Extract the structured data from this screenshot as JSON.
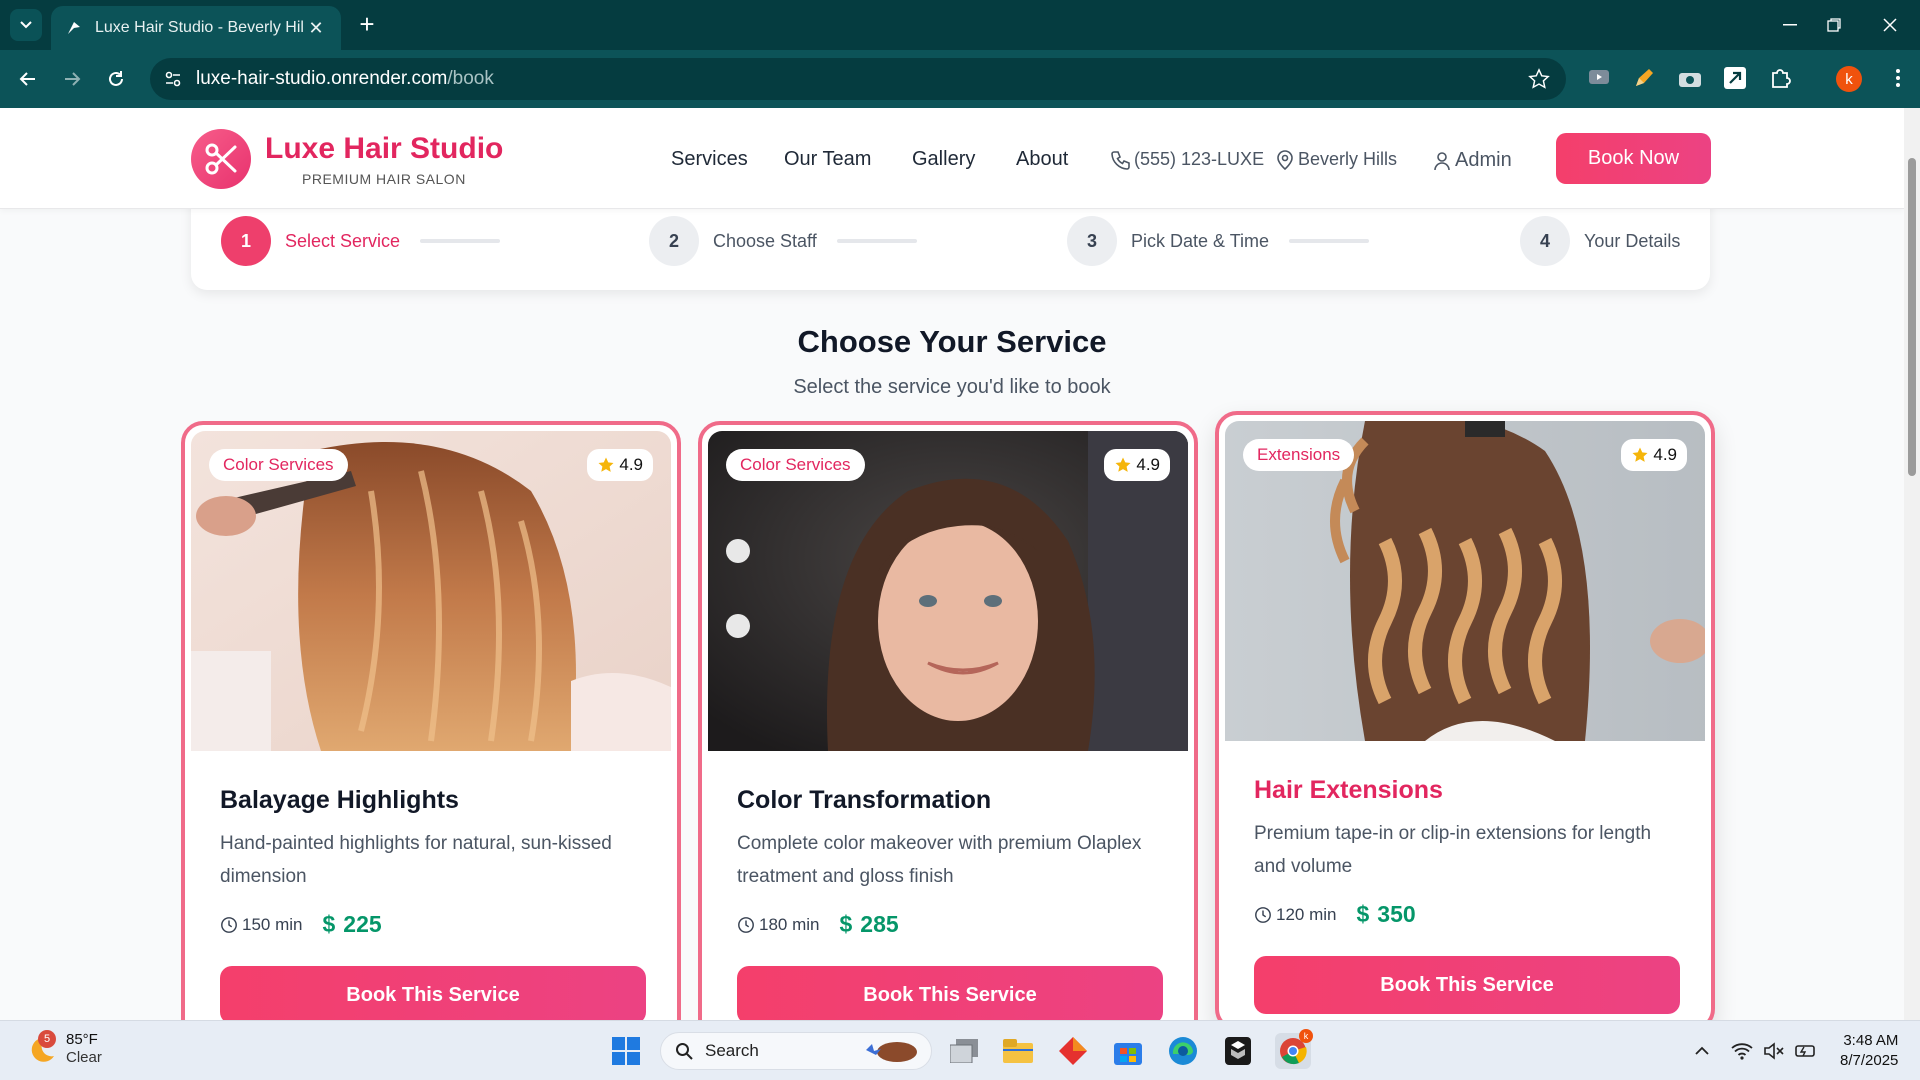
{
  "browser": {
    "tab_title": "Luxe Hair Studio - Beverly Hills |",
    "url_host": "luxe-hair-studio.onrender.com",
    "url_path": "/book",
    "profile_initial": "k"
  },
  "header": {
    "brand": "Luxe Hair Studio",
    "tagline": "PREMIUM HAIR SALON",
    "nav": [
      "Services",
      "Our Team",
      "Gallery",
      "About"
    ],
    "phone": "(555) 123-LUXE",
    "location": "Beverly Hills",
    "admin": "Admin",
    "book_now": "Book Now"
  },
  "steps": [
    {
      "num": "1",
      "label": "Select Service",
      "active": true
    },
    {
      "num": "2",
      "label": "Choose Staff",
      "active": false
    },
    {
      "num": "3",
      "label": "Pick Date & Time",
      "active": false
    },
    {
      "num": "4",
      "label": "Your Details",
      "active": false
    }
  ],
  "section": {
    "title": "Choose Your Service",
    "subtitle": "Select the service you'd like to book"
  },
  "services": [
    {
      "category": "Color Services",
      "rating": "4.9",
      "name": "Balayage Highlights",
      "description": "Hand-painted highlights for natural, sun-kissed dimension",
      "duration": "150 min",
      "price": "225",
      "button": "Book This Service"
    },
    {
      "category": "Color Services",
      "rating": "4.9",
      "name": "Color Transformation",
      "description": "Complete color makeover with premium Olaplex treatment and gloss finish",
      "duration": "180 min",
      "price": "285",
      "button": "Book This Service"
    },
    {
      "category": "Extensions",
      "rating": "4.9",
      "name": "Hair Extensions",
      "description": "Premium tape-in or clip-in extensions for length and volume",
      "duration": "120 min",
      "price": "350",
      "button": "Book This Service"
    }
  ],
  "taskbar": {
    "weather_temp": "85°F",
    "weather_desc": "Clear",
    "weather_badge": "5",
    "search": "Search",
    "time": "3:48 AM",
    "date": "8/7/2025"
  },
  "colors": {
    "brand_pink": "#e2265f",
    "price_green": "#059669",
    "chrome_teal": "#0c5358"
  }
}
